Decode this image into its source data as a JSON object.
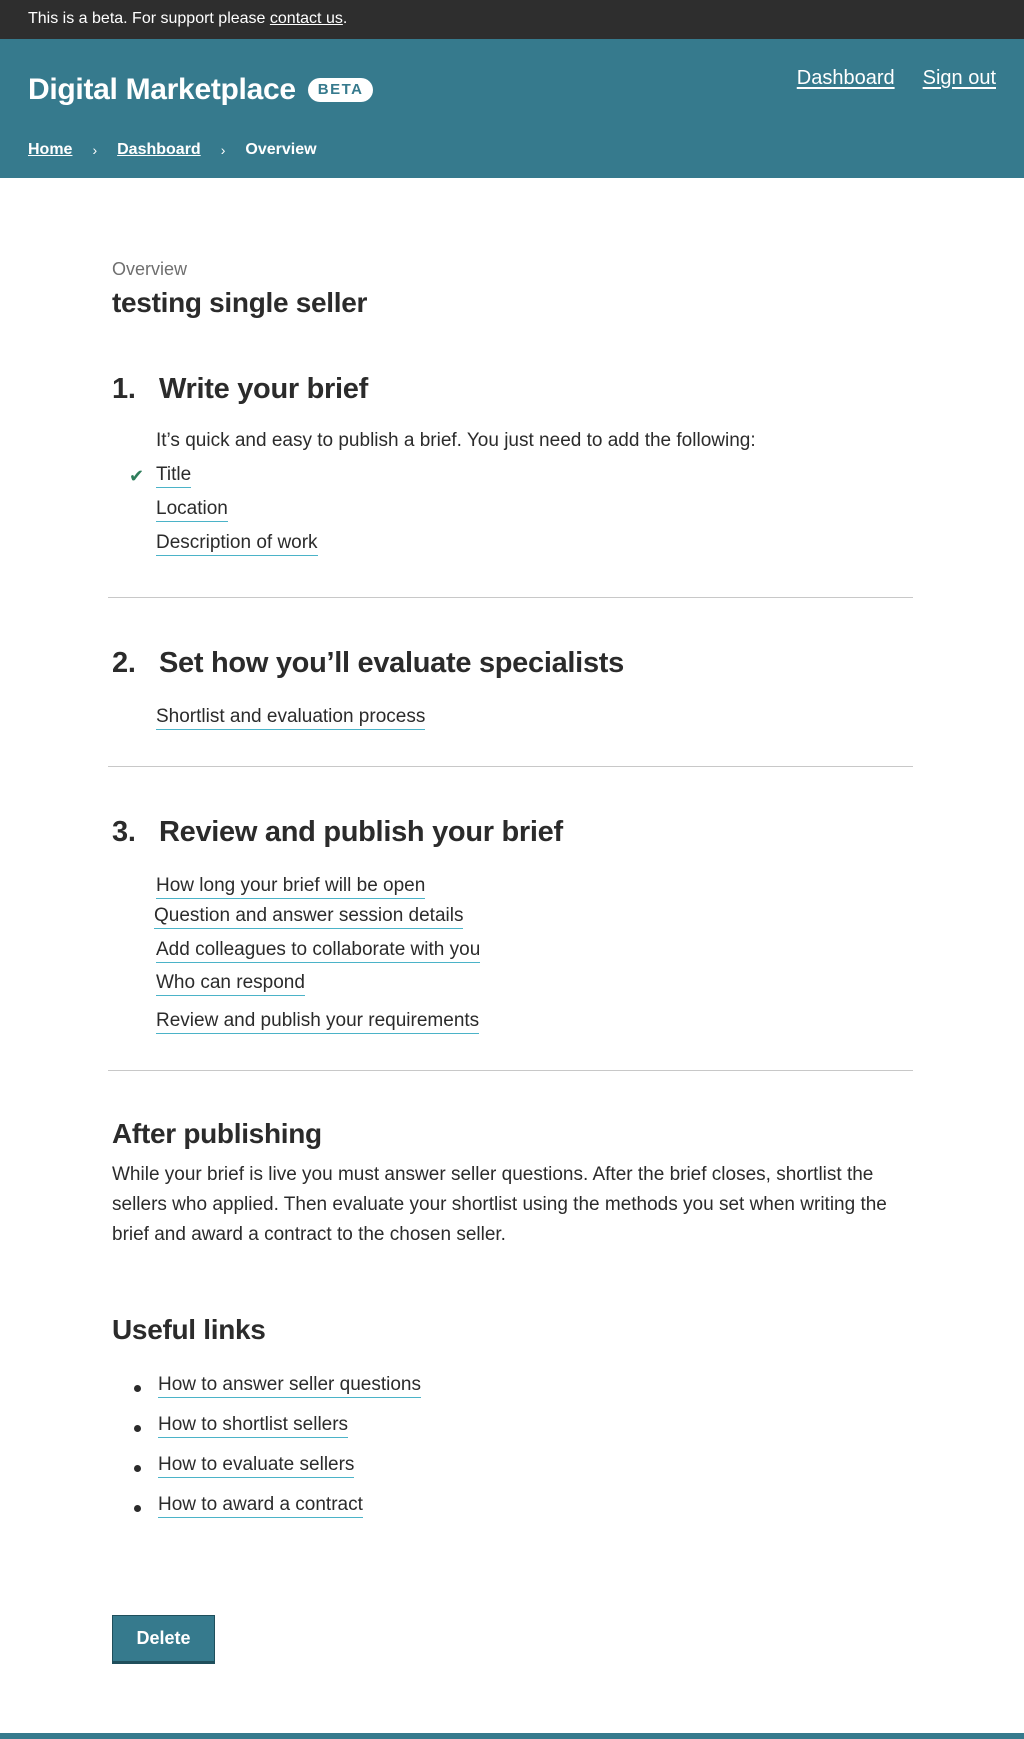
{
  "beta_banner": {
    "text": "This is a beta. For support please ",
    "link": "contact us",
    "suffix": "."
  },
  "header": {
    "title": "Digital Marketplace",
    "badge": "BETA",
    "nav": {
      "dashboard": "Dashboard",
      "sign_out": "Sign out"
    },
    "breadcrumb": {
      "home": "Home",
      "dashboard": "Dashboard",
      "current": "Overview"
    }
  },
  "page": {
    "eyebrow": "Overview",
    "title": "testing single seller"
  },
  "steps": [
    {
      "number": "1.",
      "heading": "Write your brief",
      "intro": "It’s quick and easy to publish a brief. You just need to add the following:",
      "items": [
        "Title",
        "Location",
        "Description of work"
      ]
    },
    {
      "number": "2.",
      "heading": "Set how you’ll evaluate specialists",
      "items": [
        "Shortlist and evaluation process"
      ]
    },
    {
      "number": "3.",
      "heading": "Review and publish your brief",
      "items": [
        "How long your brief will be open",
        "Question and answer session details",
        "Add colleagues to collaborate with you",
        "Who can respond",
        "Review and publish your requirements"
      ]
    }
  ],
  "after_publishing": {
    "heading": "After publishing",
    "text": "While your brief is live you must answer seller questions. After the brief closes, shortlist the sellers who applied. Then evaluate your shortlist using the methods you set when writing the brief and award a contract to the chosen seller."
  },
  "useful_links": {
    "heading": "Useful links",
    "items": [
      "How to answer seller questions",
      "How to shortlist sellers",
      "How to evaluate sellers",
      "How to award a contract"
    ]
  },
  "actions": {
    "delete": "Delete"
  },
  "colors": {
    "brand": "#367a8d",
    "link_underline": "#4bb3c8",
    "check": "#2e7d5b",
    "beta_bar": "#2e2e2e"
  },
  "icons": {
    "completed": "check-icon",
    "breadcrumb_separator": "chevron-right-icon"
  }
}
